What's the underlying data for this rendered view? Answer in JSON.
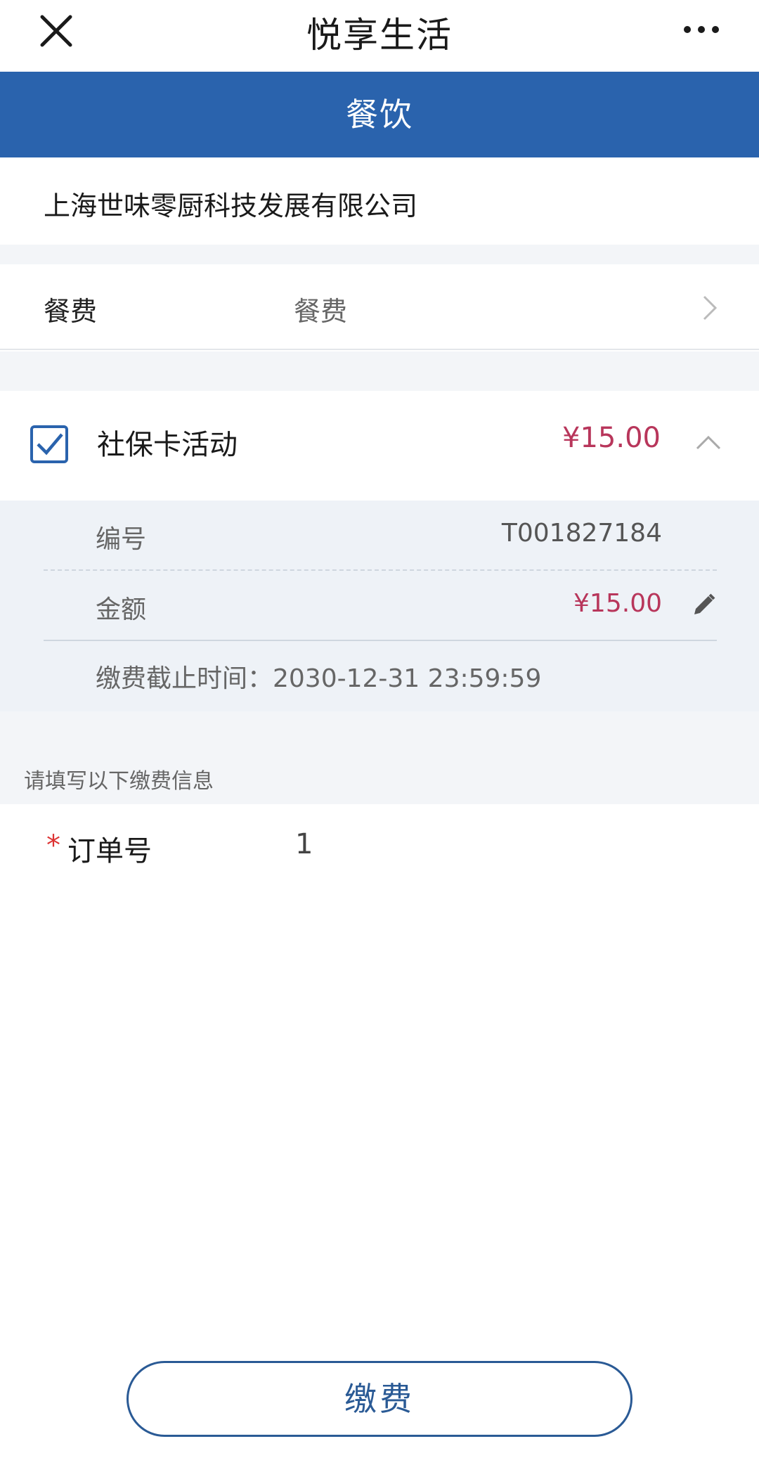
{
  "header": {
    "title": "悦享生活",
    "close_icon": "close-icon",
    "more_icon": "more-icon"
  },
  "category": "餐饮",
  "merchant": "上海世味零厨科技发展有限公司",
  "fee_type": {
    "label": "餐费",
    "value": "餐费"
  },
  "activity": {
    "name": "社保卡活动",
    "amount": "¥15.00",
    "checked": true,
    "details": {
      "number_label": "编号",
      "number_value": "T001827184",
      "amount_label": "金额",
      "amount_value": "¥15.00",
      "deadline": "缴费截止时间：2030-12-31 23:59:59"
    }
  },
  "form": {
    "hint": "请填写以下缴费信息",
    "required_mark": "*",
    "order_label": "订单号",
    "order_value": "1"
  },
  "pay_button": "缴费",
  "colors": {
    "brand_blue": "#2a63ad",
    "amount_red": "#b8365b",
    "button_border": "#2a5a95"
  }
}
